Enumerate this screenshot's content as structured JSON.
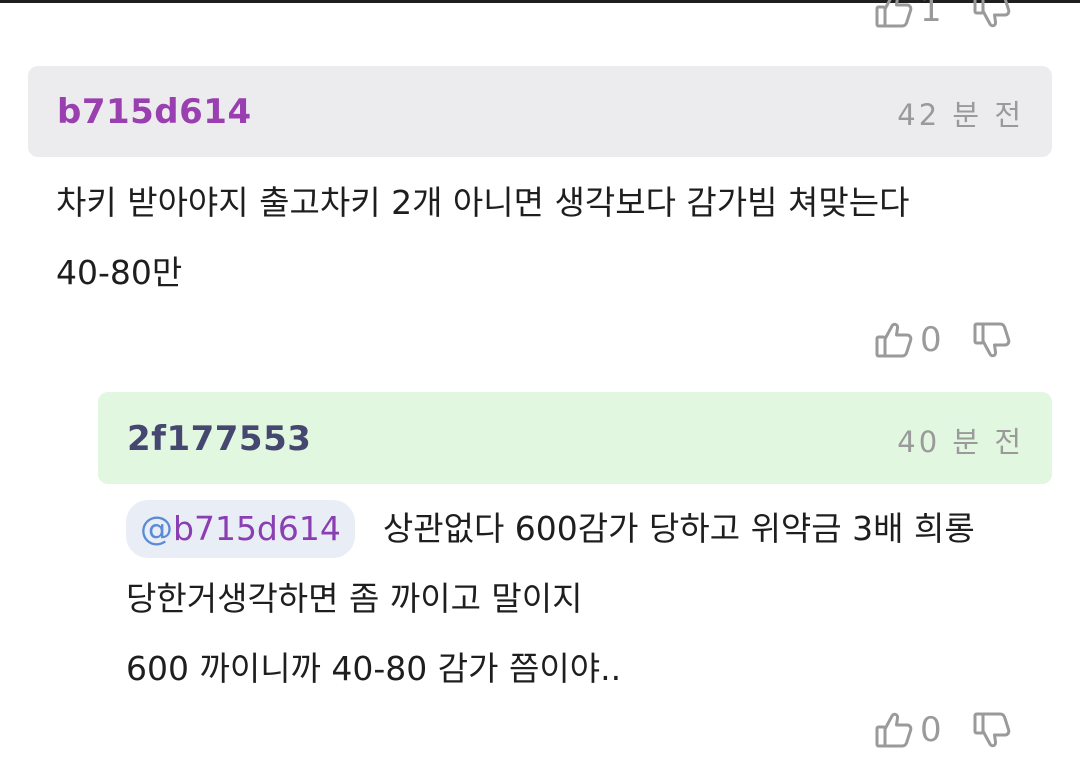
{
  "comments": [
    {
      "votes": {
        "up": "1"
      }
    },
    {
      "username": "b715d614",
      "time": "42 분 전",
      "lines": [
        "차키 받아야지 출고차키 2개 아니면 생각보다 감가빔 쳐맞는다",
        "40-80만"
      ],
      "votes": {
        "up": "0",
        "down": ""
      }
    },
    {
      "username": "2f177553",
      "time": "40 분 전",
      "mention": {
        "at": "@",
        "name": "b715d614"
      },
      "lines": [
        "상관없다 600감가 당하고 위약금 3배 희롱",
        "당한거생각하면 좀 까이고 말이지",
        "600 까이니까 40-80 감가 쯤이야.."
      ],
      "votes": {
        "up": "0",
        "down": ""
      }
    }
  ],
  "colors": {
    "header_gray": "#ececee",
    "header_green": "#e2f7df",
    "username_purple": "#9a3fb0",
    "username_navy": "#454770",
    "meta_gray": "#9a9a9a",
    "mention_bg": "#e9eef6"
  },
  "icons": {
    "like": "thumbs-up-icon",
    "dislike": "thumbs-down-icon"
  }
}
